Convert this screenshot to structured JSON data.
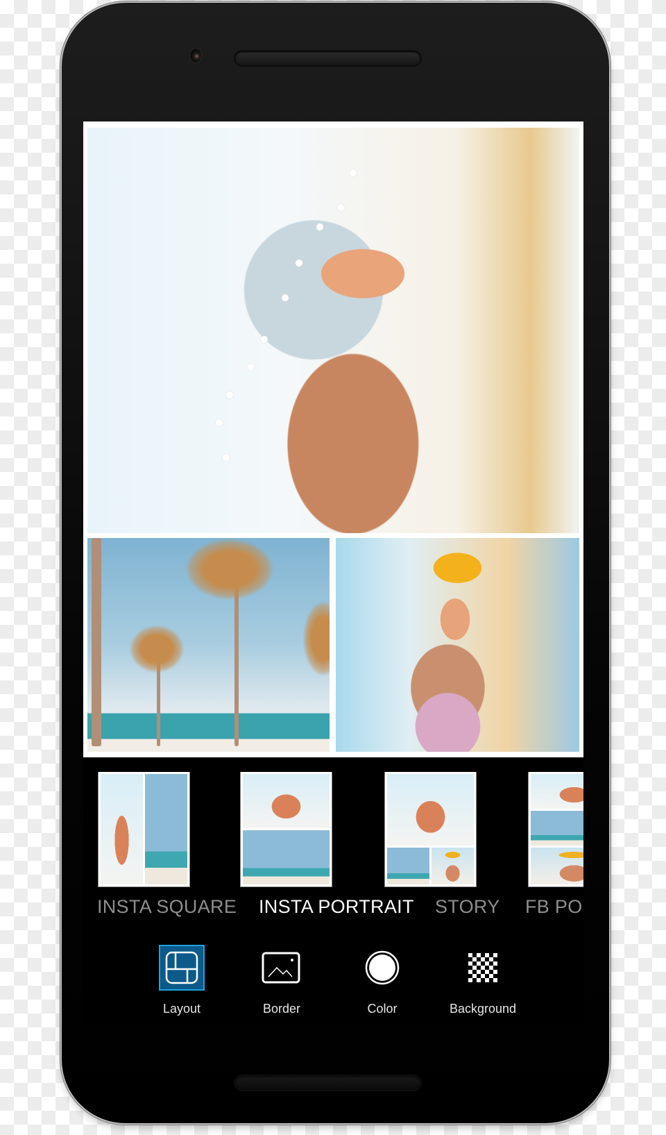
{
  "device": {
    "type": "android-phone",
    "frame_color": "#111111"
  },
  "collage": {
    "layout": "insta-portrait",
    "border_color": "#ffffff",
    "photos": [
      {
        "name": "main-portrait",
        "description": "Woman with glasses and white flowers in hair on a beach"
      },
      {
        "name": "palm-trees",
        "description": "Palm trees on a beach with turquoise sea"
      },
      {
        "name": "flower-crown-portrait",
        "description": "Woman wearing a yellow flower crown sticker"
      }
    ]
  },
  "layouts": {
    "selected_index": 1,
    "items": [
      {
        "label": "INSTA SQUARE"
      },
      {
        "label": "INSTA PORTRAIT"
      },
      {
        "label": "STORY"
      },
      {
        "label": "FB POST"
      }
    ]
  },
  "toolbar": {
    "selected_index": 0,
    "accent_color": "#1fa3e0",
    "selected_fill": "#0b5a8a",
    "items": [
      {
        "label": "Layout",
        "icon": "layout-grid-icon"
      },
      {
        "label": "Border",
        "icon": "image-frame-icon"
      },
      {
        "label": "Color",
        "icon": "color-circle-icon"
      },
      {
        "label": "Background",
        "icon": "checkerboard-icon"
      }
    ]
  }
}
